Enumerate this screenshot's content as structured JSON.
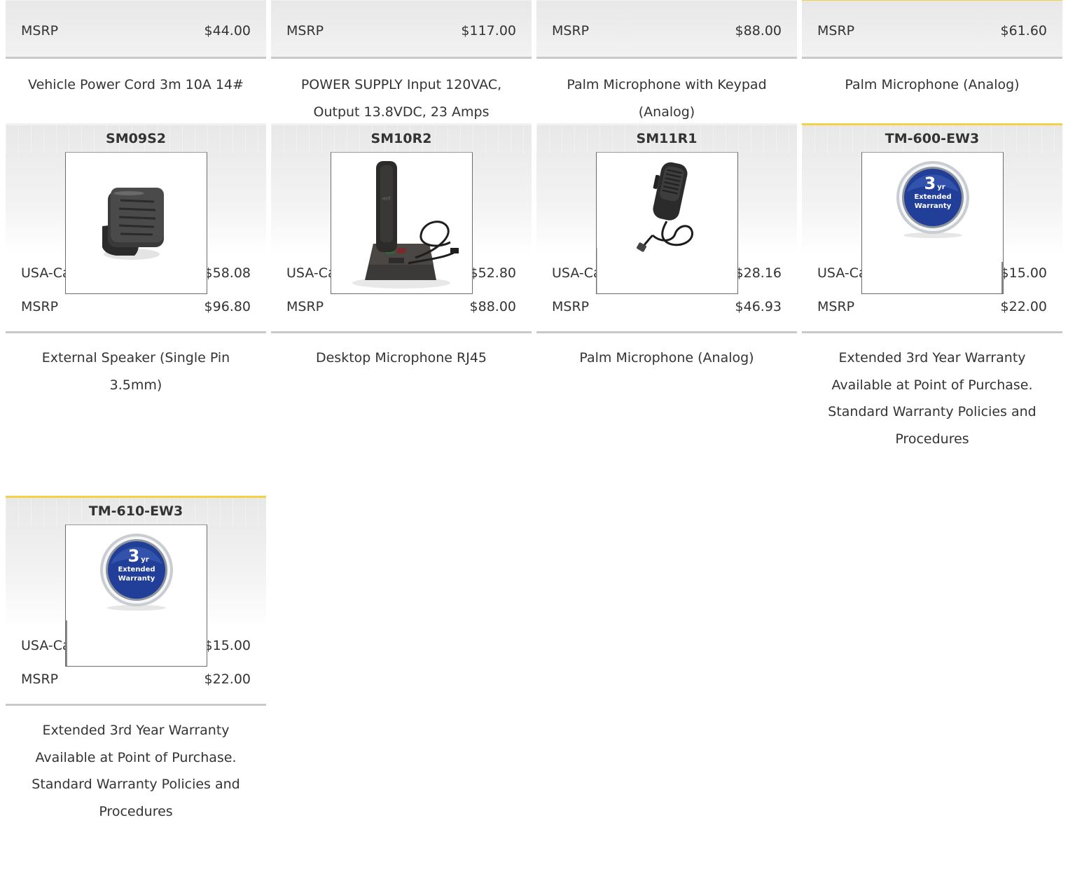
{
  "top_row": [
    {
      "msrp_label": "MSRP",
      "msrp": "$44.00",
      "description": "Vehicle Power Cord 3m 10A 14#",
      "accent": false
    },
    {
      "msrp_label": "MSRP",
      "msrp": "$117.00",
      "description": "POWER SUPPLY Input 120VAC, Output 13.8VDC, 23 Amps",
      "accent": false
    },
    {
      "msrp_label": "MSRP",
      "msrp": "$88.00",
      "description": "Palm Microphone with Keypad (Analog)",
      "accent": false
    },
    {
      "msrp_label": "MSRP",
      "msrp": "$61.60",
      "description": "Palm Microphone (Analog)",
      "accent": true
    }
  ],
  "products": [
    {
      "sku": "SM09S2",
      "image": "external-speaker-image",
      "dealer_label": "USA-Canada Dealer",
      "dealer_price": "$58.08",
      "msrp_label": "MSRP",
      "msrp": "$96.80",
      "description": "External Speaker (Single Pin 3.5mm)"
    },
    {
      "sku": "SM10R2",
      "image": "desktop-microphone-image",
      "dealer_label": "USA-Canada Dealer",
      "dealer_price": "$52.80",
      "msrp_label": "MSRP",
      "msrp": "$88.00",
      "description": "Desktop Microphone RJ45"
    },
    {
      "sku": "SM11R1",
      "image": "palm-microphone-image",
      "dealer_label": "USA-Canada Dealer",
      "dealer_price": "$28.16",
      "msrp_label": "MSRP",
      "msrp": "$46.93",
      "description": "Palm Microphone (Analog)"
    },
    {
      "sku": "TM-600-EW3",
      "image": "extended-warranty-badge",
      "badge_big": "3",
      "badge_yr": "yr",
      "badge_line1": "Extended",
      "badge_line2": "Warranty",
      "dealer_label": "USA-Canada Dealer",
      "dealer_price": "$15.00",
      "msrp_label": "MSRP",
      "msrp": "$22.00",
      "description": "Extended 3rd Year Warranty Available at Point of Purchase. Standard Warranty Policies and Procedures"
    },
    {
      "sku": "TM-610-EW3",
      "image": "extended-warranty-badge",
      "badge_big": "3",
      "badge_yr": "yr",
      "badge_line1": "Extended",
      "badge_line2": "Warranty",
      "dealer_label": "USA-Canada Dealer",
      "dealer_price": "$15.00",
      "msrp_label": "MSRP",
      "msrp": "$22.00",
      "description": "Extended 3rd Year Warranty Available at Point of Purchase. Standard Warranty Policies and Procedures"
    }
  ],
  "colors": {
    "accent_border": "#f2d24a",
    "badge_blue": "#1f3f9a",
    "text": "#333333"
  }
}
